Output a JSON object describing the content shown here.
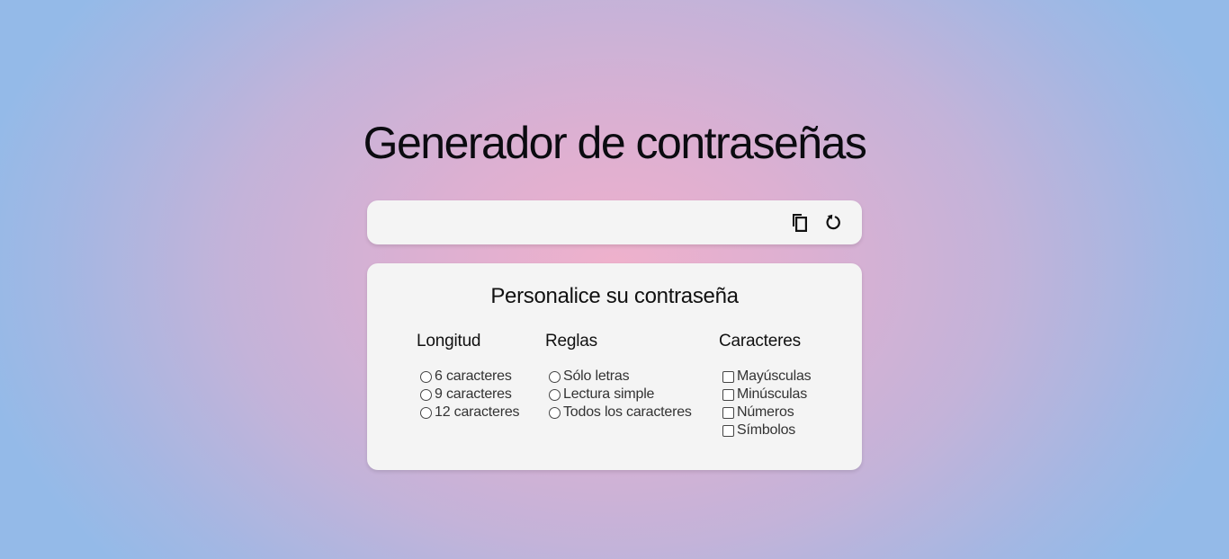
{
  "title": "Generador de contraseñas",
  "password": {
    "value": "",
    "copy_icon": "copy-icon",
    "refresh_icon": "refresh-icon"
  },
  "customize": {
    "title": "Personalice su contraseña",
    "length": {
      "heading": "Longitud",
      "options": [
        "6 caracteres",
        "9 caracteres",
        "12 caracteres"
      ]
    },
    "rules": {
      "heading": "Reglas",
      "options": [
        "Sólo letras",
        "Lectura simple",
        "Todos los caracteres"
      ]
    },
    "characters": {
      "heading": "Caracteres",
      "options": [
        "Mayúsculas",
        "Minúsculas",
        "Números",
        "Símbolos"
      ]
    }
  }
}
